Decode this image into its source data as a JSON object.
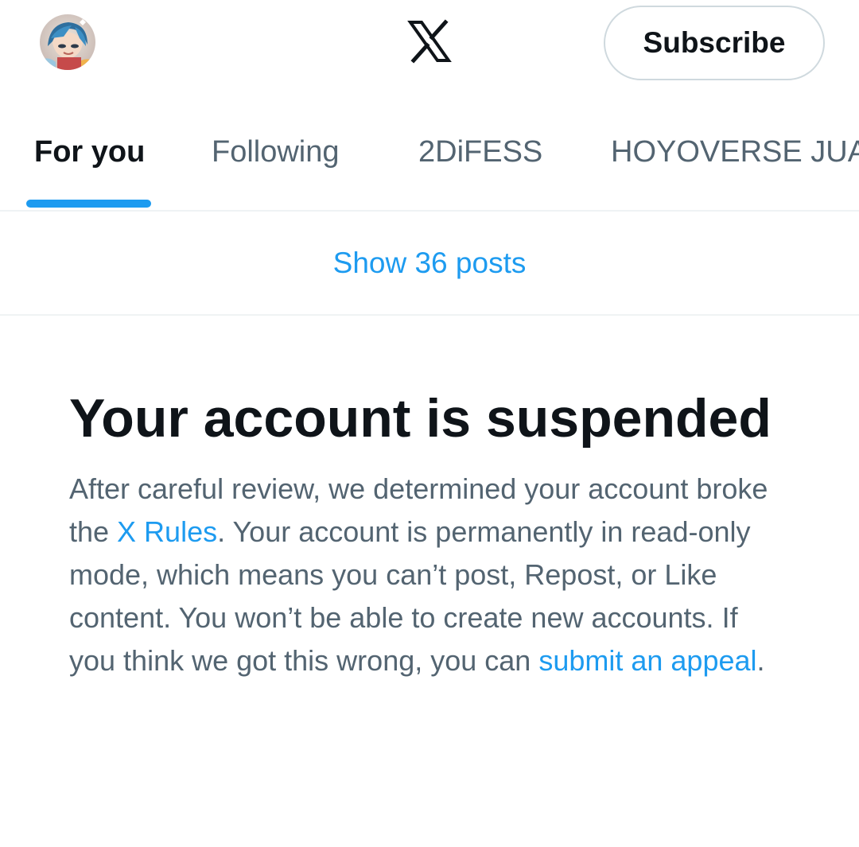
{
  "header": {
    "avatar_icon": "user-avatar",
    "logo_icon": "x-logo-icon",
    "subscribe_label": "Subscribe"
  },
  "tabs": [
    {
      "label": "For you",
      "active": true
    },
    {
      "label": "Following",
      "active": false
    },
    {
      "label": "2DiFESS",
      "active": false
    },
    {
      "label": "HOYOVERSE JUA",
      "active": false
    }
  ],
  "feed": {
    "show_posts_label": "Show 36 posts"
  },
  "notice": {
    "title": "Your account is suspended",
    "body_part1": "After careful review, we determined your account broke the ",
    "rules_link": "X Rules",
    "body_part2": ". Your account is permanently in read-only mode, which means you can’t post, Repost, or Like content. You won’t be able to create new accounts. If you think we got this wrong, you can ",
    "appeal_link": "submit an appeal",
    "body_part3": "."
  },
  "colors": {
    "accent": "#1d9bf0",
    "text_primary": "#0f1419",
    "text_secondary": "#536471",
    "divider": "#eff3f4"
  }
}
